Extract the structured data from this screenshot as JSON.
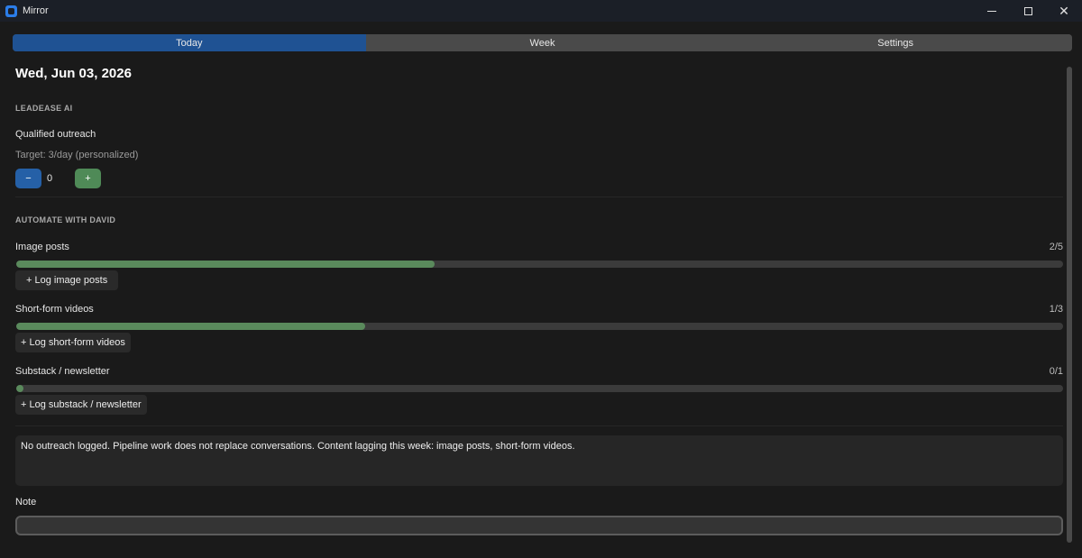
{
  "window": {
    "title": "Mirror",
    "controls": [
      "minimize",
      "maximize",
      "close"
    ]
  },
  "tabs": [
    {
      "label": "Today",
      "active": true
    },
    {
      "label": "Week",
      "active": false
    },
    {
      "label": "Settings",
      "active": false
    }
  ],
  "date": "Wed, Jun 03, 2026",
  "leadease": {
    "section_title": "LEADEASE AI",
    "metric_label": "Qualified outreach",
    "target": "Target: 3/day (personalized)",
    "minus_label": "−",
    "value": "0",
    "plus_label": "+"
  },
  "automate": {
    "section_title": "AUTOMATE WITH DAVID",
    "items": [
      {
        "label": "Image posts",
        "count": "2/5",
        "progress": 0.4,
        "button": "+ Log image posts"
      },
      {
        "label": "Short-form videos",
        "count": "1/3",
        "progress": 0.333,
        "button": "+ Log short-form videos"
      },
      {
        "label": "Substack / newsletter",
        "count": "0/1",
        "progress": 0.0,
        "button": "+ Log substack / newsletter"
      }
    ]
  },
  "message": "No outreach logged. Pipeline work does not replace conversations. Content lagging this week: image posts, short-form videos.",
  "note": {
    "label": "Note",
    "value": "",
    "placeholder": ""
  },
  "colors": {
    "accent_blue": "#1f5293",
    "progress_green": "#5a8a5c",
    "plus_green": "#4f8a57",
    "background": "#1a1a1a"
  }
}
